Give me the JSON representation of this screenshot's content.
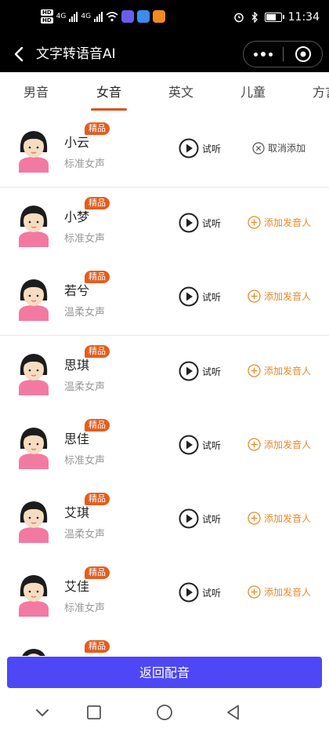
{
  "status_bar": {
    "time": "11:34",
    "network_left": "4G",
    "network_right": "4G",
    "hd_top": "HD",
    "hd_bottom": "HD"
  },
  "header": {
    "title": "文字转语音AI"
  },
  "tabs": [
    {
      "label": "男音",
      "active": false
    },
    {
      "label": "女音",
      "active": true
    },
    {
      "label": "英文",
      "active": false
    },
    {
      "label": "儿童",
      "active": false
    },
    {
      "label": "方言",
      "active": false
    }
  ],
  "voices": [
    {
      "name": "小云",
      "subtitle": "标准女声",
      "badge": "精品",
      "play_label": "试听",
      "action_label": "取消添加",
      "action_type": "remove"
    },
    {
      "name": "小梦",
      "subtitle": "标准女声",
      "badge": "精品",
      "play_label": "试听",
      "action_label": "添加发音人",
      "action_type": "add"
    },
    {
      "name": "若兮",
      "subtitle": "温柔女声",
      "badge": "精品",
      "play_label": "试听",
      "action_label": "添加发音人",
      "action_type": "add"
    },
    {
      "name": "思琪",
      "subtitle": "温柔女声",
      "badge": "精品",
      "play_label": "试听",
      "action_label": "添加发音人",
      "action_type": "add"
    },
    {
      "name": "思佳",
      "subtitle": "标准女声",
      "badge": "精品",
      "play_label": "试听",
      "action_label": "添加发音人",
      "action_type": "add"
    },
    {
      "name": "艾琪",
      "subtitle": "温柔女声",
      "badge": "精品",
      "play_label": "试听",
      "action_label": "添加发音人",
      "action_type": "add"
    },
    {
      "name": "艾佳",
      "subtitle": "标准女声",
      "badge": "精品",
      "play_label": "试听",
      "action_label": "添加发音人",
      "action_type": "add"
    },
    {
      "name": "",
      "subtitle": "",
      "badge": "精品",
      "play_label": "",
      "action_label": "",
      "action_type": "add"
    }
  ],
  "footer": {
    "button_label": "返回配音"
  },
  "colors": {
    "accent": "#e55c1e",
    "tab_underline": "#e04e1b",
    "add_action": "#e58a2c",
    "primary_button": "#4d47f5"
  },
  "icons": {
    "back": "back-arrow-icon",
    "more": "more-dots-icon",
    "close": "target-circle-icon",
    "play": "play-circle-icon",
    "add": "plus-circle-icon",
    "remove": "x-circle-icon",
    "sys_back": "triangle-back-icon",
    "sys_home": "circle-home-icon",
    "sys_recent": "square-recent-icon",
    "sys_down": "chevron-down-icon"
  }
}
